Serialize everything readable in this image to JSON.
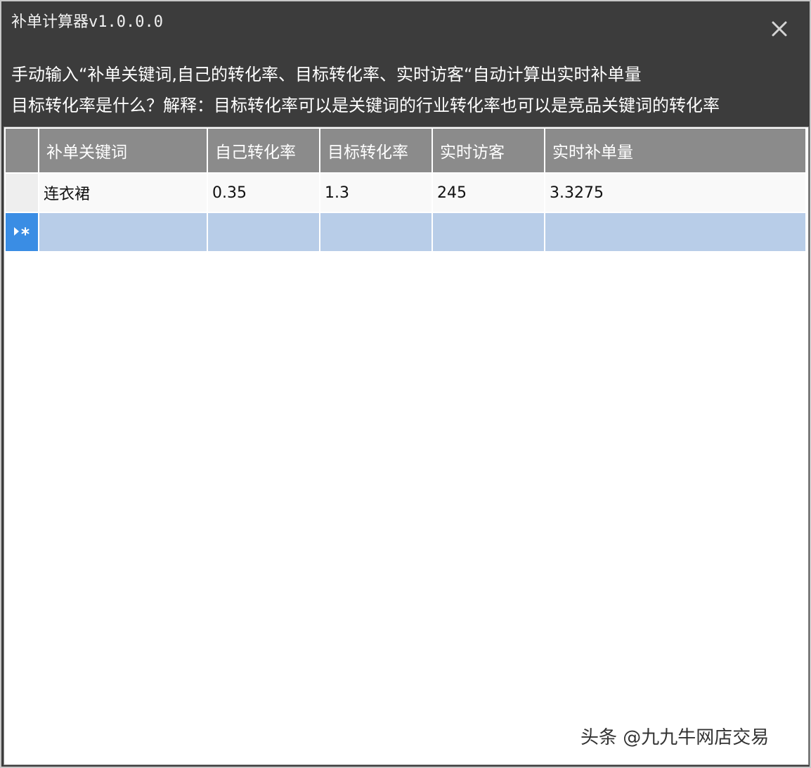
{
  "window": {
    "title": "补单计算器v1.0.0.0"
  },
  "instructions": {
    "line1": "手动输入“补单关键词,自己的转化率、目标转化率、实时访客“自动计算出实时补单量",
    "line2": "目标转化率是什么？解释：目标转化率可以是关键词的行业转化率也可以是竞品关键词的转化率"
  },
  "grid": {
    "columns": [
      "补单关键词",
      "自己转化率",
      "目标转化率",
      "实时访客",
      "实时补单量"
    ],
    "rows": [
      {
        "keyword": "连衣裙",
        "own_rate": "0.35",
        "target_rate": "1.3",
        "visitors": "245",
        "result": "3.3275"
      }
    ]
  },
  "watermark": "头条 @九九牛网店交易",
  "icons": {
    "close": "close-icon",
    "new_row": "new-row-indicator-icon"
  },
  "colors": {
    "title_bar": "#3c3c3c",
    "header_bg": "#8b8b8b",
    "selected_row": "#b8cde8",
    "indicator_bg": "#3a8de4"
  }
}
